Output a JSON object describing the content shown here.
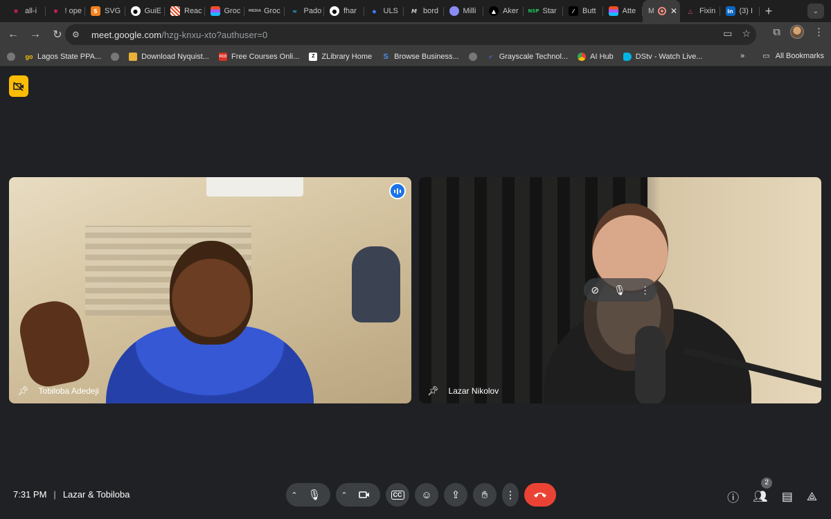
{
  "browser": {
    "tabs": [
      {
        "title": "all-i",
        "icon": "slack-icon",
        "color": "#e01e5a"
      },
      {
        "title": "! ope",
        "icon": "slack-icon",
        "color": "#e01e5a"
      },
      {
        "title": "SVG",
        "icon": "svg-icon",
        "color": "#f5821f"
      },
      {
        "title": "GuiE",
        "icon": "github-icon",
        "color": "#ffffff"
      },
      {
        "title": "Reac",
        "icon": "grid-icon",
        "color": "#e34c26"
      },
      {
        "title": "Groc",
        "icon": "figma-icon",
        "color": "#f24e1e"
      },
      {
        "title": "Groc",
        "icon": "text-logo-icon",
        "color": "#aaaaaa"
      },
      {
        "title": "Pado",
        "icon": "tailwind-icon",
        "color": "#38bdf8"
      },
      {
        "title": "fhar",
        "icon": "github-icon",
        "color": "#ffffff"
      },
      {
        "title": "ULS",
        "icon": "diamond-icon",
        "color": "#3b82f6"
      },
      {
        "title": "bord",
        "icon": "m-icon",
        "color": "#cccccc"
      },
      {
        "title": "Milli",
        "icon": "circle-icon",
        "color": "#8b8bf5"
      },
      {
        "title": "Aker",
        "icon": "triangle-icon",
        "color": "#ffffff"
      },
      {
        "title": "Star",
        "icon": "nsp-icon",
        "color": "#22c55e"
      },
      {
        "title": "Butt",
        "icon": "slash-icon",
        "color": "#ffffff"
      },
      {
        "title": "Atte",
        "icon": "figma-icon",
        "color": "#f24e1e"
      }
    ],
    "active_tab": {
      "title": "M",
      "icon": "recording-icon"
    },
    "tabs_after": [
      {
        "title": "Fixin",
        "icon": "triangle-outline-icon",
        "color": "#e8556c"
      },
      {
        "title": "(3) I",
        "icon": "linkedin-icon",
        "color": "#0a66c2",
        "badge": "in"
      }
    ],
    "url_host": "meet.google.com",
    "url_path": "/hzg-knxu-xto?authuser=0",
    "bookmarks": [
      {
        "label": "",
        "icon": "globe-icon"
      },
      {
        "label": "Lagos State PPA...",
        "icon": "go-icon",
        "badge": "go"
      },
      {
        "label": "Download Nyquist...",
        "icon": "globe-icon"
      },
      {
        "label": "",
        "icon": "emoji-icon"
      },
      {
        "label": "Free Courses Onli...",
        "icon": "fco-icon",
        "badge": "FCO"
      },
      {
        "label": "ZLibrary Home",
        "icon": "z-icon",
        "badge": "Z"
      },
      {
        "label": "Browse Business...",
        "icon": "s-icon",
        "badge": "S"
      },
      {
        "label": "",
        "icon": "globe-icon"
      },
      {
        "label": "Grayscale Technol...",
        "icon": "feather-icon"
      },
      {
        "label": "AI Hub",
        "icon": "chrome-icon"
      },
      {
        "label": "DStv - Watch Live...",
        "icon": "dstv-icon"
      }
    ],
    "more_bookmarks": "»",
    "all_bookmarks": "All Bookmarks"
  },
  "meet": {
    "participants": [
      {
        "name": "Tobiloba Adedeji",
        "speaking": true
      },
      {
        "name": "Lazar Nikolov",
        "speaking": false
      }
    ],
    "time": "7:31 PM",
    "separator": "|",
    "meeting_title": "Lazar & Tobiloba",
    "people_count": "2",
    "leave_color": "#ea4335",
    "accent": "#1a73e8",
    "no_camera_color": "#fbbc04"
  }
}
